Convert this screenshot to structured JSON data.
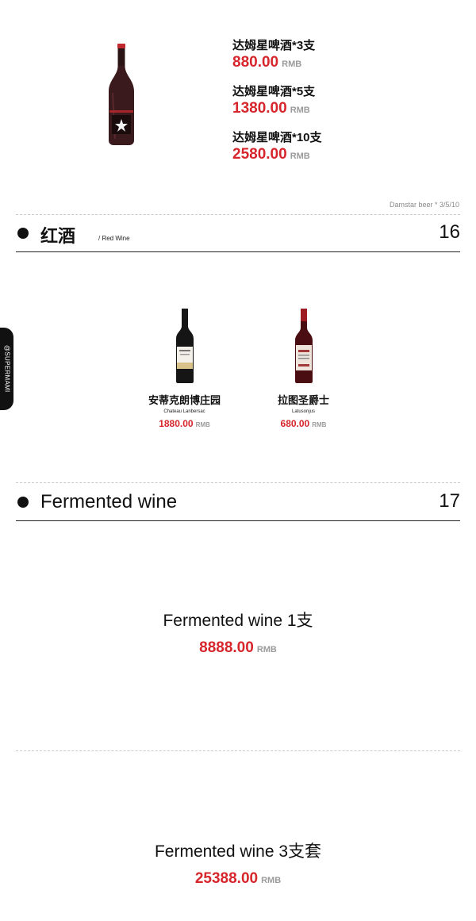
{
  "beer": {
    "offers": [
      {
        "name": "达姆星啤酒*3支",
        "price": "880.00",
        "unit": "RMB"
      },
      {
        "name": "达姆星啤酒*5支",
        "price": "1380.00",
        "unit": "RMB"
      },
      {
        "name": "达姆星啤酒*10支",
        "price": "2580.00",
        "unit": "RMB"
      }
    ],
    "footnote": "Damstar beer * 3/5/10"
  },
  "red_wine_section": {
    "title": "红酒",
    "subtitle": "/ Red Wine",
    "number": "16",
    "items": [
      {
        "name": "安蒂克朗博庄园",
        "en": "Chateau Lanbersac",
        "price": "1880.00",
        "unit": "RMB"
      },
      {
        "name": "拉图圣爵士",
        "en": "Latusonjus",
        "price": "680.00",
        "unit": "RMB"
      }
    ]
  },
  "fermented_section": {
    "title": "Fermented wine",
    "number": "17",
    "items": [
      {
        "name": "Fermented wine 1支",
        "price": "8888.00",
        "unit": "RMB"
      },
      {
        "name": "Fermented wine 3支套",
        "price": "25388.00",
        "unit": "RMB"
      }
    ]
  },
  "side_tab": {
    "label": "@SUPERMAMI"
  },
  "colors": {
    "price": "#d6262c",
    "unit": "#9a9a9a",
    "text": "#111111",
    "tab": "#111111"
  }
}
